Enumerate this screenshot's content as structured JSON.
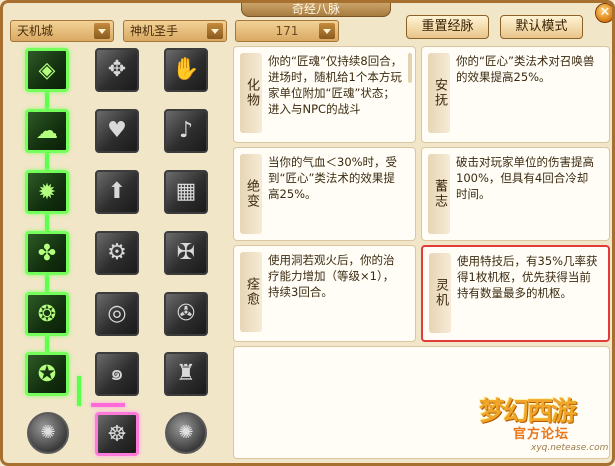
{
  "window": {
    "title": "奇经八脉"
  },
  "filters": {
    "school": "天机城",
    "faction": "神机圣手",
    "level": "171"
  },
  "buttons": {
    "reset": "重置经脉",
    "default": "默认模式"
  },
  "skill_icons": {
    "col1": [
      "diamond-rune-icon",
      "swirl-cloud-icon",
      "sun-burst-icon",
      "figure-rune-icon",
      "gear-flower-icon",
      "orb-rune-icon"
    ],
    "col2": [
      "clover-knot-icon",
      "heart-icon",
      "arrow-up-icon",
      "gear-circle-icon",
      "spiral-icon",
      "spiral-icon"
    ],
    "col3": [
      "hand-icon",
      "bell-icon",
      "wall-icon",
      "chain-icon",
      "horn-icon",
      "golem-icon"
    ],
    "bottom": [
      "spiral-coin-icon",
      "mech-core-icon",
      "spiral-coin-icon"
    ]
  },
  "cards": [
    {
      "name": "化物",
      "text": "你的“匠魂”仅持续8回合，进场时，随机给1个本方玩家单位附加“匠魂”状态；进入与NPC的战斗"
    },
    {
      "name": "安抚",
      "text": "你的“匠心”类法术对召唤兽的效果提高25%。"
    },
    {
      "name": "绝变",
      "text": "当你的气血＜30%时，受到“匠心”类法术的效果提高25%。"
    },
    {
      "name": "蓄志",
      "text": "破击对玩家单位的伤害提高100%，但具有4回合冷却时间。"
    },
    {
      "name": "痊愈",
      "text": "使用洞若观火后，你的治疗能力增加（等级×1），持续3回合。"
    },
    {
      "name": "灵机",
      "text": "使用特技后，有35%几率获得1枚机枢，优先获得当前持有数量最多的机枢。"
    }
  ],
  "watermark": {
    "logo": "梦幻西游",
    "sub": "官方论坛",
    "url": "xyq.netease.com"
  }
}
